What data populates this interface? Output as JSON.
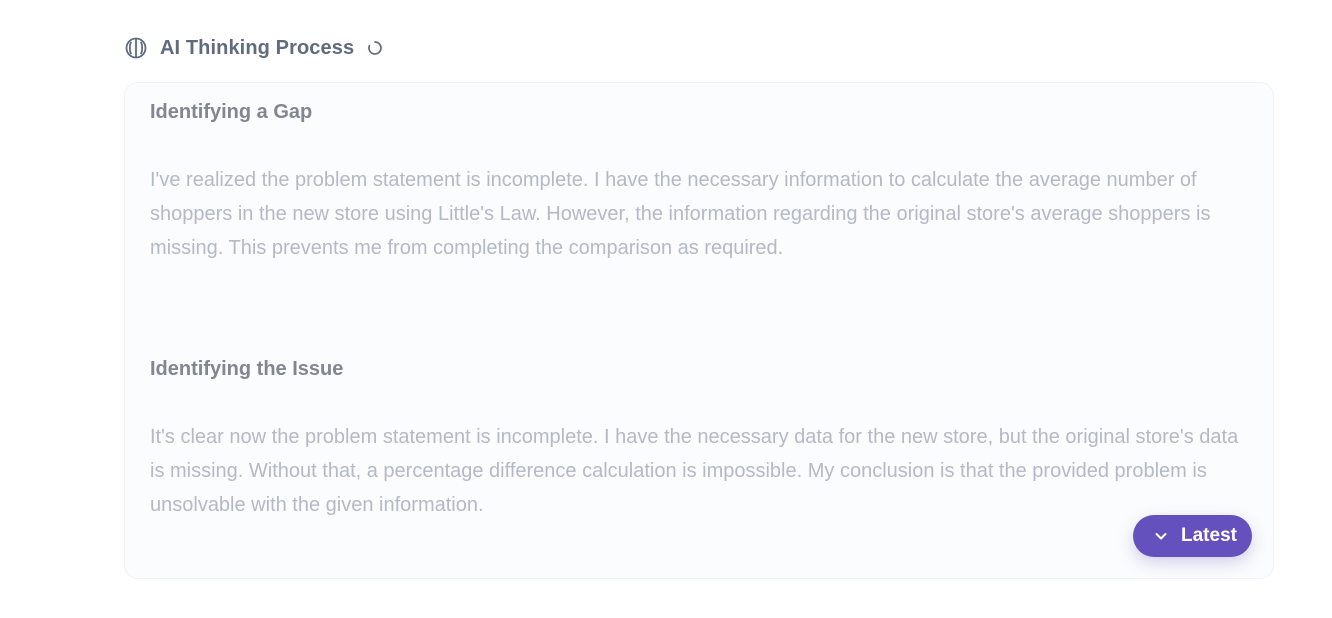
{
  "header": {
    "title": "AI Thinking Process",
    "icon": "brain-icon",
    "status_icon": "loading-spinner-icon"
  },
  "sections": [
    {
      "title": "Identifying a Gap",
      "body": "I've realized the problem statement is incomplete. I have the necessary information to calculate the average number of shoppers in the new store using Little's Law. However, the information regarding the original store's average shoppers is missing. This prevents me from completing the comparison as required."
    },
    {
      "title": "Identifying the Issue",
      "body": "It's clear now the problem statement is incomplete. I have the necessary data for the new store, but the original store's data is missing. Without that, a percentage difference calculation is impossible. My conclusion is that the provided problem is unsolvable with the given information."
    }
  ],
  "latest_button": {
    "label": "Latest",
    "icon": "chevron-down-icon"
  },
  "colors": {
    "accent": "#6551bd",
    "title_text": "#5f6b7f",
    "section_title": "#818691",
    "body_text": "#b3b9c6",
    "panel_bg": "#fbfcfd"
  }
}
